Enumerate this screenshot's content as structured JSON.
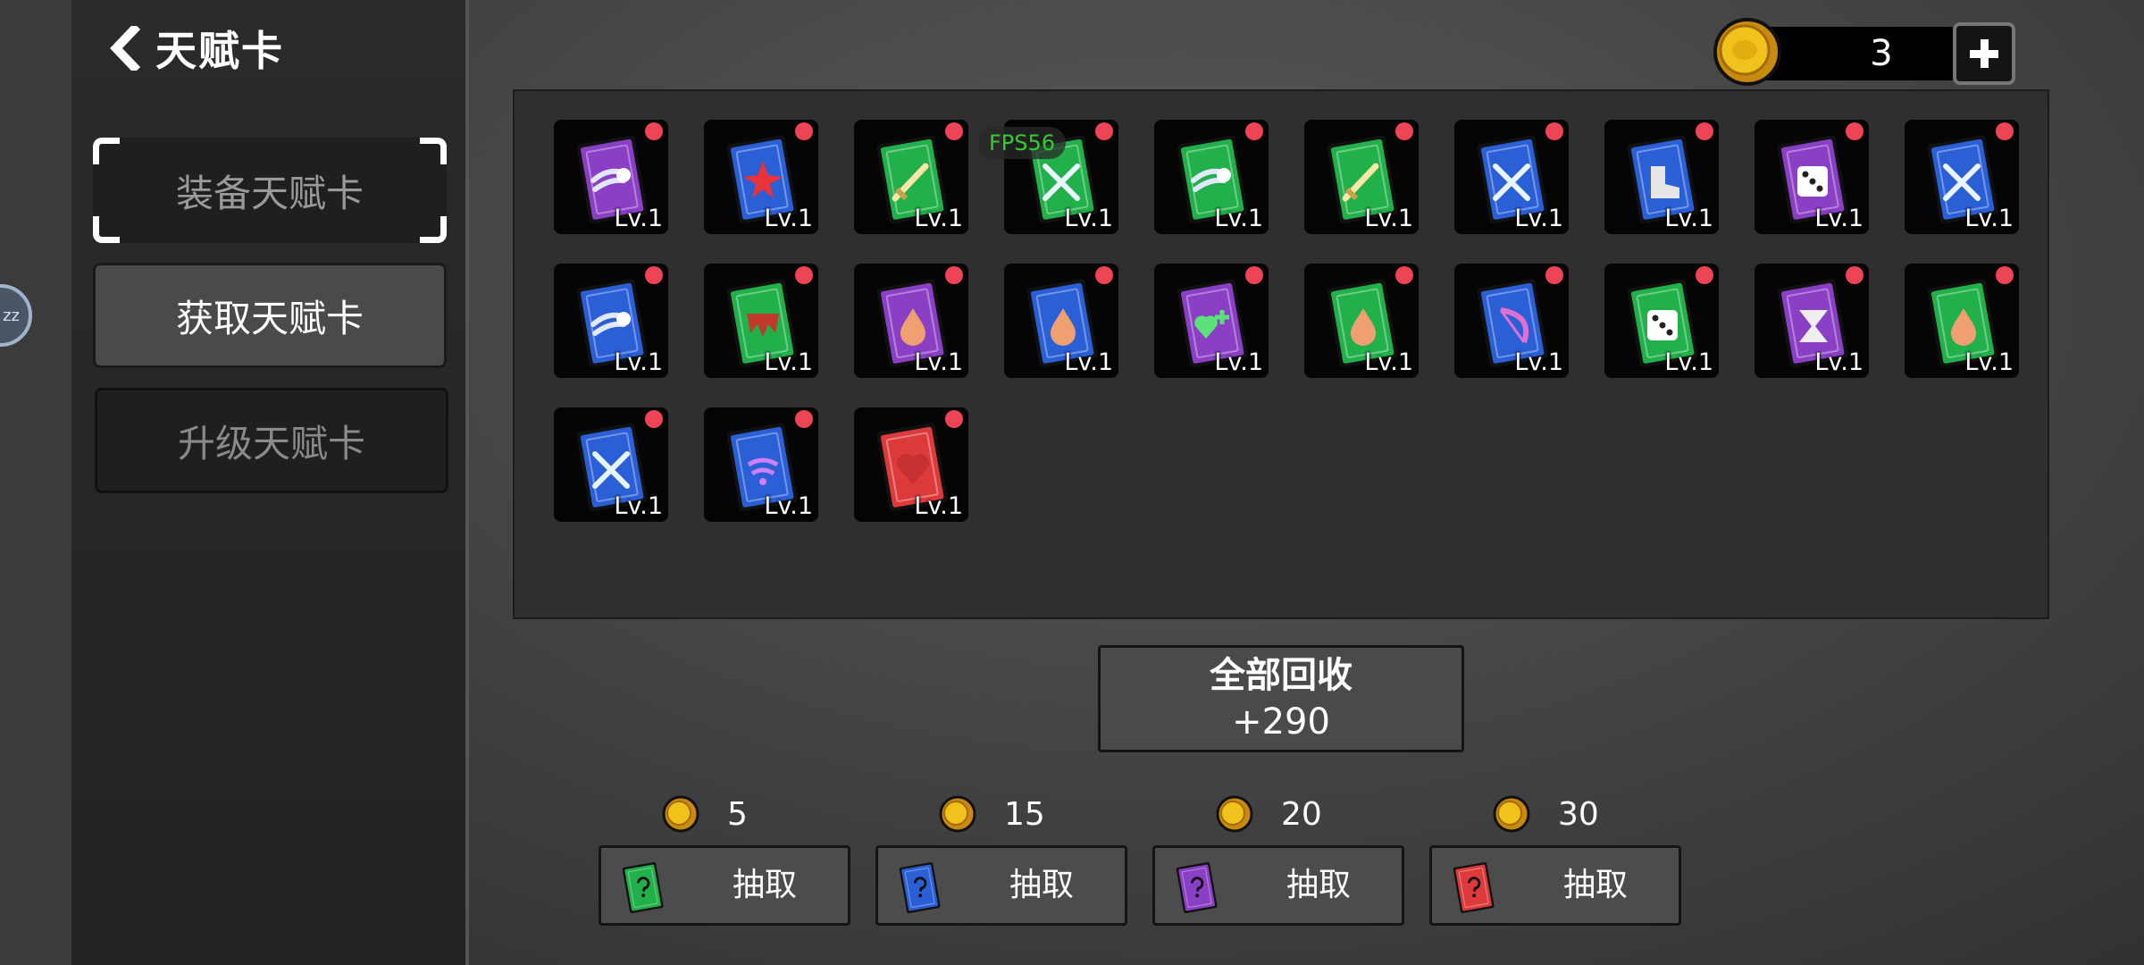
{
  "sidebar": {
    "title": "天赋卡",
    "menu": [
      {
        "label": "装备天赋卡"
      },
      {
        "label": "获取天赋卡"
      },
      {
        "label": "升级天赋卡"
      }
    ]
  },
  "avatar": {
    "text": "zz"
  },
  "currency": {
    "count": "3",
    "icon": "gold-coin-icon"
  },
  "overlay": {
    "fps": "FPS56"
  },
  "cards": [
    {
      "color": "purple",
      "icon": "dash-icon",
      "level": "Lv.1"
    },
    {
      "color": "blue",
      "icon": "star-burst-icon",
      "level": "Lv.1"
    },
    {
      "color": "green",
      "icon": "sword-icon",
      "level": "Lv.1"
    },
    {
      "color": "green",
      "icon": "crossed-swords-icon",
      "level": "Lv.1"
    },
    {
      "color": "green",
      "icon": "dash-icon",
      "level": "Lv.1"
    },
    {
      "color": "green",
      "icon": "sword-icon",
      "level": "Lv.1"
    },
    {
      "color": "blue",
      "icon": "crossed-swords-icon",
      "level": "Lv.1"
    },
    {
      "color": "blue",
      "icon": "boot-icon",
      "level": "Lv.1"
    },
    {
      "color": "purple",
      "icon": "dice-icon",
      "level": "Lv.1"
    },
    {
      "color": "blue",
      "icon": "crossed-swords-icon",
      "level": "Lv.1"
    },
    {
      "color": "blue",
      "icon": "dash-icon",
      "level": "Lv.1"
    },
    {
      "color": "green",
      "icon": "fang-icon",
      "level": "Lv.1"
    },
    {
      "color": "purple",
      "icon": "drop-icon",
      "level": "Lv.1"
    },
    {
      "color": "blue",
      "icon": "drop-icon",
      "level": "Lv.1"
    },
    {
      "color": "purple",
      "icon": "heart-plus-icon",
      "level": "Lv.1"
    },
    {
      "color": "green",
      "icon": "drop-icon",
      "level": "Lv.1"
    },
    {
      "color": "blue",
      "icon": "bow-icon",
      "level": "Lv.1"
    },
    {
      "color": "green",
      "icon": "dice-icon",
      "level": "Lv.1"
    },
    {
      "color": "purple",
      "icon": "hourglass-icon",
      "level": "Lv.1"
    },
    {
      "color": "green",
      "icon": "drop-icon",
      "level": "Lv.1"
    },
    {
      "color": "blue",
      "icon": "crossed-swords-icon",
      "level": "Lv.1"
    },
    {
      "color": "blue",
      "icon": "wave-icon",
      "level": "Lv.1"
    },
    {
      "color": "red",
      "icon": "heart-icon",
      "level": "Lv.1"
    }
  ],
  "recycle": {
    "label": "全部回收",
    "value": "+290"
  },
  "draws": [
    {
      "cost": "5",
      "label": "抽取",
      "color": "green"
    },
    {
      "cost": "15",
      "label": "抽取",
      "color": "blue"
    },
    {
      "cost": "20",
      "label": "抽取",
      "color": "purple"
    },
    {
      "cost": "30",
      "label": "抽取",
      "color": "red"
    }
  ],
  "colors": {
    "green": "#22b04a",
    "blue": "#2a5fd6",
    "purple": "#8a3fc4",
    "red": "#dd3b3b",
    "notification": "#ee4455",
    "fps": "#33cc33"
  }
}
